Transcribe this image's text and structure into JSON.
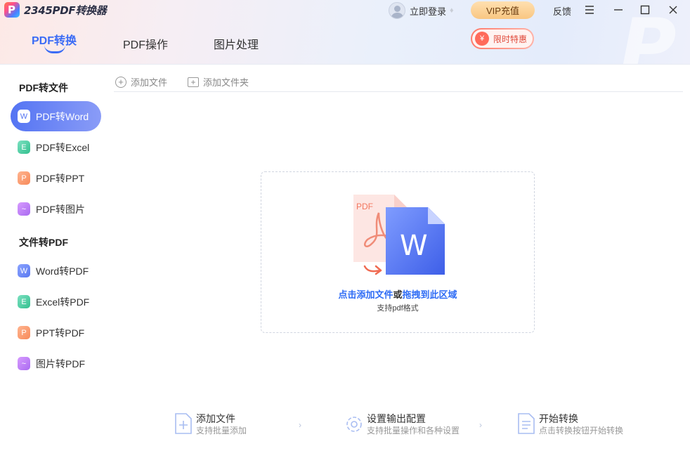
{
  "app": {
    "name": "2345PDF转换器"
  },
  "header": {
    "login_label": "立即登录",
    "vip_label": "VIP充值",
    "feedback_label": "反馈",
    "promo_label": "限时特惠",
    "promo_icon": "¥",
    "tabs": [
      {
        "label": "PDF转换",
        "active": true
      },
      {
        "label": "PDF操作",
        "active": false
      },
      {
        "label": "图片处理",
        "active": false
      }
    ]
  },
  "sidebar": {
    "groups": [
      {
        "title": "PDF转文件",
        "items": [
          {
            "label": "PDF转Word",
            "icon": "word-icon",
            "glyph": "W",
            "active": true
          },
          {
            "label": "PDF转Excel",
            "icon": "excel-icon",
            "glyph": "E",
            "active": false
          },
          {
            "label": "PDF转PPT",
            "icon": "ppt-icon",
            "glyph": "P",
            "active": false
          },
          {
            "label": "PDF转图片",
            "icon": "image-icon",
            "glyph": "~",
            "active": false
          }
        ]
      },
      {
        "title": "文件转PDF",
        "items": [
          {
            "label": "Word转PDF",
            "icon": "word-icon",
            "glyph": "W",
            "active": false
          },
          {
            "label": "Excel转PDF",
            "icon": "excel-icon",
            "glyph": "E",
            "active": false
          },
          {
            "label": "PPT转PDF",
            "icon": "ppt-icon",
            "glyph": "P",
            "active": false
          },
          {
            "label": "图片转PDF",
            "icon": "image-icon",
            "glyph": "~",
            "active": false
          }
        ]
      }
    ]
  },
  "toolbar": {
    "add_file_label": "添加文件",
    "add_folder_label": "添加文件夹"
  },
  "dropzone": {
    "pdf_tag": "PDF",
    "word_glyph": "W",
    "text_click": "点击添加文件",
    "text_or": "或",
    "text_drag": "拖拽到此区域",
    "subtitle": "支持pdf格式"
  },
  "steps": [
    {
      "title": "添加文件",
      "desc": "支持批量添加"
    },
    {
      "title": "设置输出配置",
      "desc": "支持批量操作和各种设置"
    },
    {
      "title": "开始转换",
      "desc": "点击转换按钮开始转换"
    }
  ],
  "colors": {
    "accent": "#3b6cf5",
    "active_nav_start": "#5474f3",
    "active_nav_end": "#8a9cf7",
    "vip": "#f9c782",
    "promo": "#ff6b5b"
  }
}
